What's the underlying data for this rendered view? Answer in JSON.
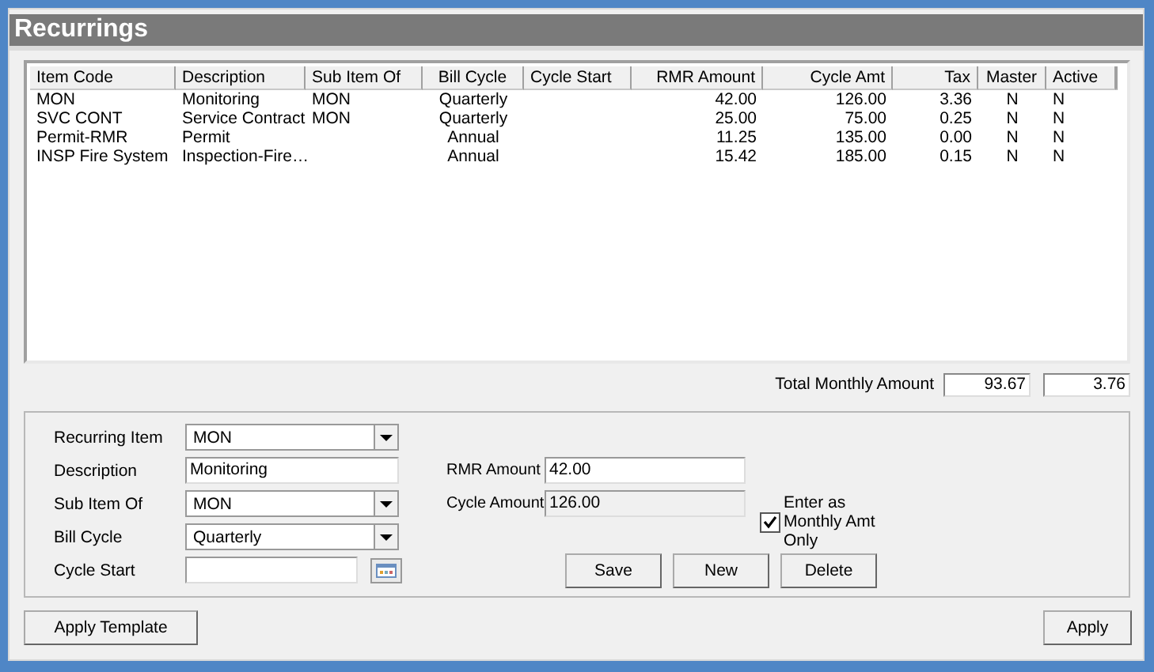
{
  "window": {
    "title": "Recurrings"
  },
  "table": {
    "columns": [
      "Item Code",
      "Description",
      "Sub Item Of",
      "Bill Cycle",
      "Cycle Start",
      "RMR Amount",
      "Cycle Amt",
      "Tax",
      "Master",
      "Active"
    ],
    "rows": [
      {
        "cells": [
          "MON",
          "Monitoring",
          "MON",
          "Quarterly",
          "",
          "42.00",
          "126.00",
          "3.36",
          "N",
          "N"
        ]
      },
      {
        "cells": [
          "SVC CONT",
          "Service Contract",
          "MON",
          "Quarterly",
          "",
          "25.00",
          "75.00",
          "0.25",
          "N",
          "N"
        ]
      },
      {
        "cells": [
          "Permit-RMR",
          "Permit",
          "",
          "Annual",
          "",
          "11.25",
          "135.00",
          "0.00",
          "N",
          "N"
        ]
      },
      {
        "cells": [
          "INSP Fire System",
          "Inspection-Fire…",
          "",
          "Annual",
          "",
          "15.42",
          "185.00",
          "0.15",
          "N",
          "N"
        ]
      }
    ]
  },
  "totals": {
    "label": "Total Monthly Amount",
    "values": [
      "93.67",
      "3.76"
    ]
  },
  "form": {
    "left": [
      {
        "kind": "dropdown",
        "label": "Recurring Item",
        "value": "MON"
      },
      {
        "kind": "text",
        "label": "Description",
        "value": "Monitoring"
      },
      {
        "kind": "dropdown",
        "label": "Sub Item Of",
        "value": "MON"
      },
      {
        "kind": "dropdown",
        "label": "Bill Cycle",
        "value": "Quarterly"
      },
      {
        "kind": "date",
        "label": "Cycle Start"
      }
    ],
    "right": [
      {
        "kind": "text",
        "label": "RMR Amount",
        "value": "42.00"
      },
      {
        "kind": "readonly",
        "label": "Cycle Amount",
        "value": "126.00"
      }
    ],
    "checkbox": {
      "label": "Enter as Monthly Amt Only",
      "checked": true
    },
    "buttons": [
      "Save",
      "New",
      "Delete"
    ]
  },
  "footer": {
    "left_button": "Apply Template",
    "right_button": "Apply"
  }
}
